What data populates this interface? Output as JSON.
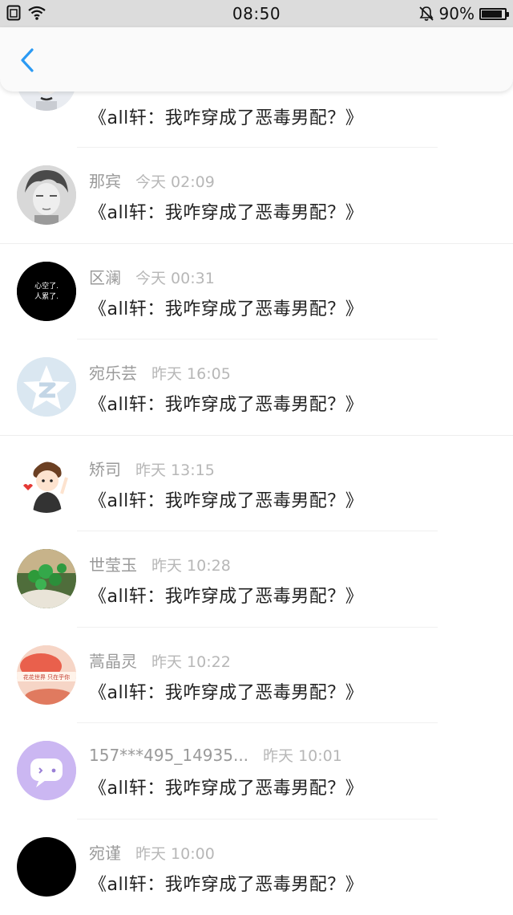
{
  "status": {
    "time": "08:50",
    "battery_text": "90%",
    "battery_level": 0.9
  },
  "header": {
    "back_icon": "chevron-left-icon",
    "accent": "#2b9af3"
  },
  "items": [
    {
      "name": "",
      "time": "",
      "message": "《all轩：我咋穿成了恶毒男配？》",
      "avatar": "anime-girl"
    },
    {
      "name": "那宾",
      "time": "今天 02:09",
      "message": "《all轩：我咋穿成了恶毒男配？》",
      "avatar": "sketch-boy"
    },
    {
      "name": "区澜",
      "time": "今天 00:31",
      "message": "《all轩：我咋穿成了恶毒男配？》",
      "avatar": "black-text",
      "avatar_text": [
        "心空了.",
        "人累了."
      ]
    },
    {
      "name": "宛乐芸",
      "time": "昨天 16:05",
      "message": "《all轩：我咋穿成了恶毒男配？》",
      "avatar": "qq-default"
    },
    {
      "name": "矫司",
      "time": "昨天 13:15",
      "message": "《all轩：我咋穿成了恶毒男配？》",
      "avatar": "cartoon-boy"
    },
    {
      "name": "世莹玉",
      "time": "昨天 10:28",
      "message": "《all轩：我咋穿成了恶毒男配？》",
      "avatar": "green-plant"
    },
    {
      "name": "蒿晶灵",
      "time": "昨天 10:22",
      "message": "《all轩：我咋穿成了恶毒男配？》",
      "avatar": "red-banner",
      "avatar_text": [
        "花花世界 只在乎你"
      ]
    },
    {
      "name": "157***495_14935...",
      "time": "昨天 10:01",
      "message": "《all轩：我咋穿成了恶毒男配？》",
      "avatar": "chat-bubble"
    },
    {
      "name": "宛谨",
      "time": "昨天 10:00",
      "message": "《all轩：我咋穿成了恶毒男配？》",
      "avatar": "black"
    }
  ]
}
